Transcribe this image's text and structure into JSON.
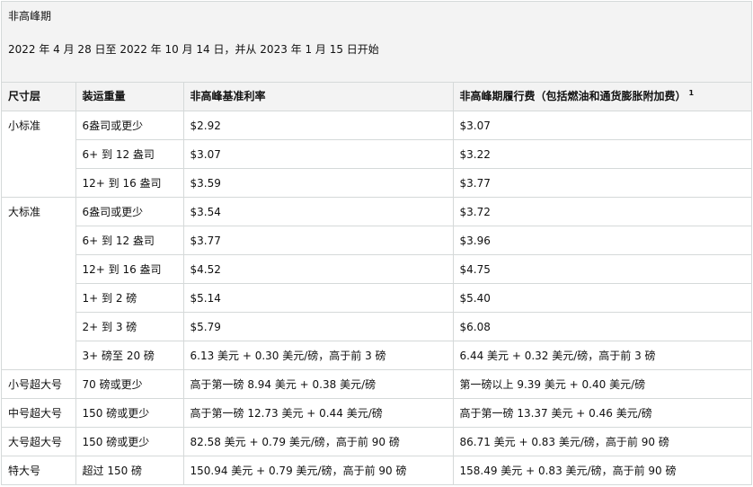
{
  "header": {
    "title": "非高峰期",
    "subtitle": "2022 年 4 月 28 日至 2022 年 10 月 14 日，并从 2023 年 1 月 15 日开始"
  },
  "table": {
    "columns": [
      "尺寸层",
      "装运重量",
      "非高峰基准利率",
      "非高峰期履行费（包括燃油和通货膨胀附加费）"
    ],
    "footnote_mark": "1",
    "groups": [
      {
        "tier": "小标准",
        "rows": [
          {
            "weight": "6盎司或更少",
            "base": "$2.92",
            "fee": "$3.07"
          },
          {
            "weight": "6+ 到 12 盎司",
            "base": "$3.07",
            "fee": "$3.22"
          },
          {
            "weight": "12+ 到 16 盎司",
            "base": "$3.59",
            "fee": "$3.77"
          }
        ]
      },
      {
        "tier": "大标准",
        "rows": [
          {
            "weight": "6盎司或更少",
            "base": "$3.54",
            "fee": "$3.72"
          },
          {
            "weight": "6+ 到 12 盎司",
            "base": "$3.77",
            "fee": "$3.96"
          },
          {
            "weight": "12+ 到 16 盎司",
            "base": "$4.52",
            "fee": "$4.75"
          },
          {
            "weight": "1+ 到 2 磅",
            "base": "$5.14",
            "fee": "$5.40"
          },
          {
            "weight": "2+ 到 3 磅",
            "base": "$5.79",
            "fee": "$6.08"
          },
          {
            "weight": "3+ 磅至 20 磅",
            "base": "6.13 美元 + 0.30 美元/磅，高于前 3 磅",
            "fee": "6.44 美元 + 0.32 美元/磅，高于前 3 磅"
          }
        ]
      },
      {
        "tier": "小号超大号",
        "rows": [
          {
            "weight": "70 磅或更少",
            "base": "高于第一磅 8.94 美元 + 0.38 美元/磅",
            "fee": "第一磅以上 9.39 美元 + 0.40 美元/磅"
          }
        ]
      },
      {
        "tier": "中号超大号",
        "rows": [
          {
            "weight": "150 磅或更少",
            "base": "高于第一磅 12.73 美元 + 0.44 美元/磅",
            "fee": "高于第一磅 13.37 美元 + 0.46 美元/磅"
          }
        ]
      },
      {
        "tier": "大号超大号",
        "rows": [
          {
            "weight": "150 磅或更少",
            "base": "82.58 美元 + 0.79 美元/磅，高于前 90 磅",
            "fee": "86.71 美元 + 0.83 美元/磅，高于前 90 磅"
          }
        ]
      },
      {
        "tier": "特大号",
        "rows": [
          {
            "weight": "超过 150 磅",
            "base": "150.94 美元 + 0.79 美元/磅，高于前 90 磅",
            "fee": "158.49 美元 + 0.83 美元/磅，高于前 90 磅"
          }
        ]
      }
    ]
  }
}
